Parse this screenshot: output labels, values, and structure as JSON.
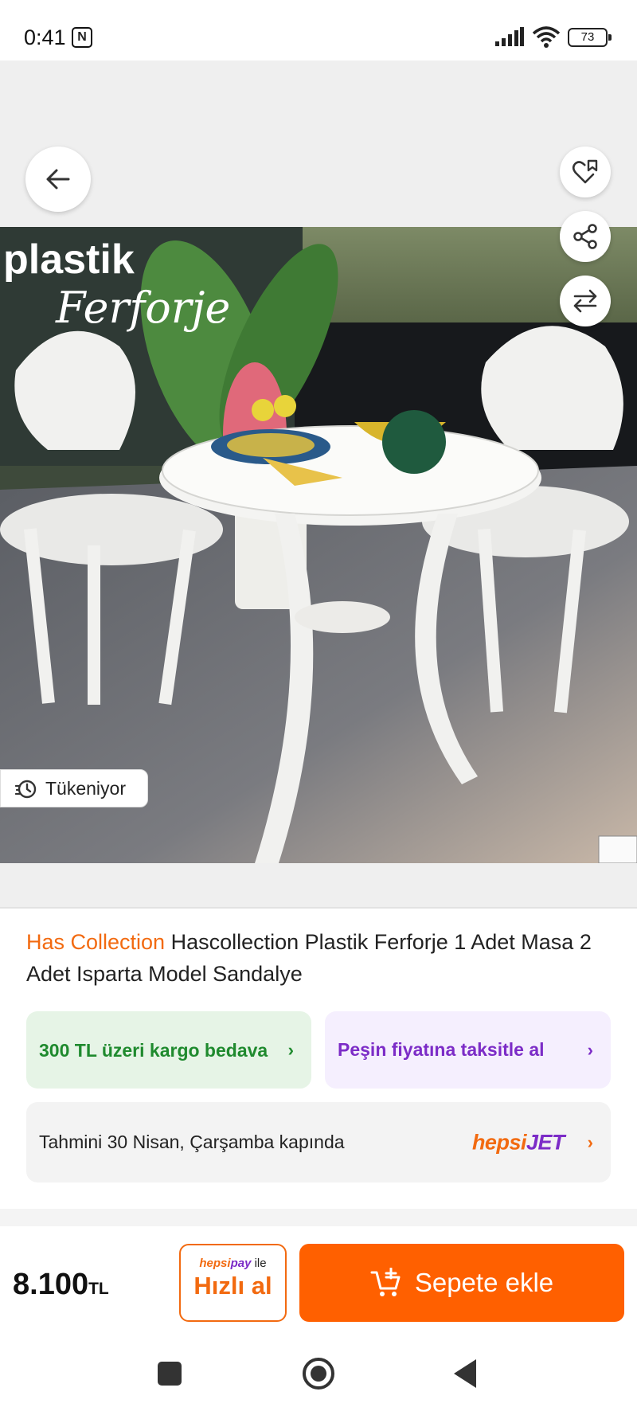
{
  "status_bar": {
    "time": "0:41",
    "nfc_icon_label": "N",
    "battery_level": "73"
  },
  "gallery": {
    "image_overlay_text_top": "plastik",
    "image_overlay_text_script": "Ferforje",
    "stock_badge": "Tükeniyor"
  },
  "product": {
    "brand": "Has Collection",
    "title": "Hascollection Plastik Ferforje 1 Adet Masa 2 Adet Isparta Model Sandalye"
  },
  "promos": {
    "cargo": "300 TL üzeri kargo bedava",
    "installment": "Peşin fiyatına taksitle al",
    "delivery": "Tahmini 30 Nisan, Çarşamba kapında",
    "carrier_part1": "hepsi",
    "carrier_part2": "JET",
    "chevron": "›"
  },
  "bottom_bar": {
    "price": "8.100",
    "currency": "TL",
    "quick_pay_brand_1": "hepsi",
    "quick_pay_brand_2": "pay",
    "quick_pay_ile": " ile",
    "quick_buy_label": "Hızlı al",
    "add_to_cart_label": "Sepete ekle"
  },
  "colors": {
    "brand_orange": "#ff6000",
    "purple": "#7c2cc7",
    "green": "#1f8a2e"
  }
}
